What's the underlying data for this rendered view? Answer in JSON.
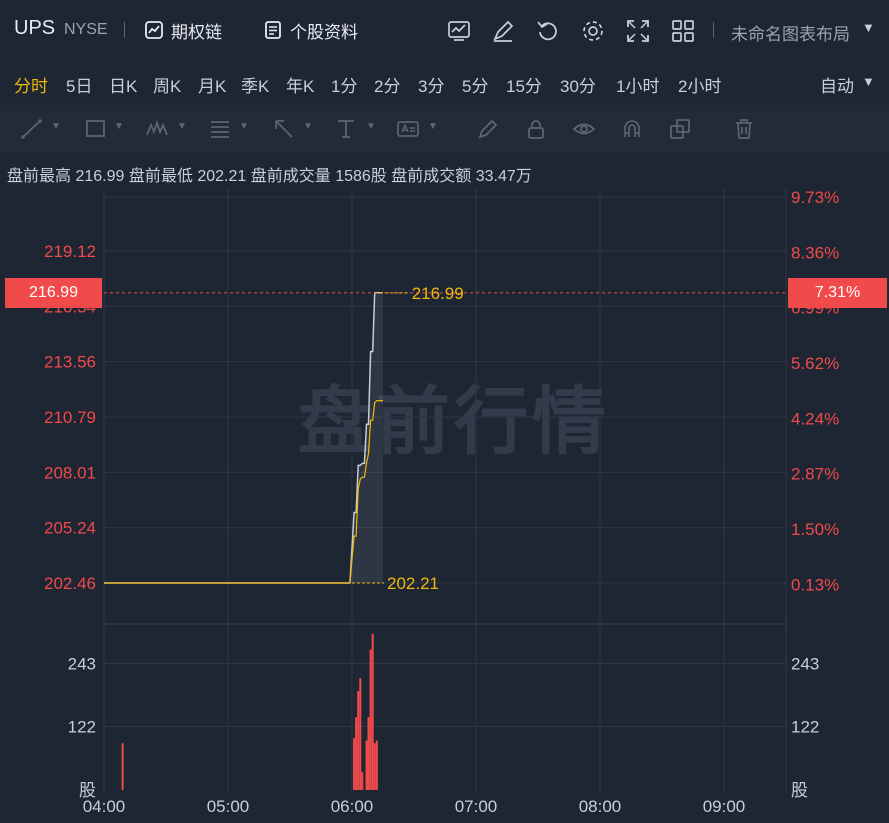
{
  "header": {
    "ticker": "UPS",
    "exchange": "NYSE",
    "options_chain_label": "期权链",
    "profile_label": "个股资料",
    "layout_name": "未命名图表布局"
  },
  "periods": [
    {
      "label": "分时",
      "active": true
    },
    {
      "label": "5日",
      "active": false
    },
    {
      "label": "日K",
      "active": false
    },
    {
      "label": "周K",
      "active": false
    },
    {
      "label": "月K",
      "active": false
    },
    {
      "label": "季K",
      "active": false
    },
    {
      "label": "年K",
      "active": false
    },
    {
      "label": "1分",
      "active": false
    },
    {
      "label": "2分",
      "active": false
    },
    {
      "label": "3分",
      "active": false
    },
    {
      "label": "5分",
      "active": false
    },
    {
      "label": "15分",
      "active": false
    },
    {
      "label": "30分",
      "active": false
    },
    {
      "label": "1小时",
      "active": false
    },
    {
      "label": "2小时",
      "active": false
    }
  ],
  "auto_label": "自动",
  "info": {
    "high_label": "盘前最高",
    "high_value": "216.99",
    "low_label": "盘前最低",
    "low_value": "202.21",
    "volume_label": "盘前成交量",
    "volume_value": "1586股",
    "amount_label": "盘前成交额",
    "amount_value": "33.47万"
  },
  "watermark": "盘前行情",
  "colors": {
    "up": "#f04a4a",
    "avg": "#f0b90b",
    "price": "#c8ccd4",
    "bg": "#1e2533",
    "grid": "#2f3746"
  },
  "chart_data": [
    {
      "type": "line",
      "title": "",
      "x_ticks": [
        "04:00",
        "05:00",
        "06:00",
        "07:00",
        "08:00",
        "09:00"
      ],
      "y_ticks_left": [
        "219.12",
        "216.34",
        "213.56",
        "210.79",
        "208.01",
        "205.24",
        "202.46"
      ],
      "y_ticks_right": [
        "9.73%",
        "8.36%",
        "6.99%",
        "5.62%",
        "4.24%",
        "2.87%",
        "1.50%",
        "0.13%"
      ],
      "ylim": [
        202.21,
        219.12
      ],
      "current_price_label": "216.99",
      "current_pct_label": "7.31%",
      "high_marker": "216.99",
      "low_marker": "202.21",
      "series": [
        {
          "x": [
            "04:00",
            "05:59",
            "06:01",
            "06:02",
            "06:03",
            "06:04",
            "06:05",
            "06:06",
            "06:07",
            "06:08",
            "06:09",
            "06:10",
            "06:11",
            "06:12",
            "06:13",
            "06:14",
            "06:15"
          ],
          "values": [
            202.21,
            202.21,
            205.8,
            205.8,
            208.2,
            208.2,
            208.3,
            208.3,
            210.3,
            210.3,
            214.0,
            214.0,
            216.99,
            216.99,
            216.99,
            216.99,
            216.99
          ]
        },
        {
          "x": [
            "04:00",
            "05:59",
            "06:01",
            "06:02",
            "06:03",
            "06:04",
            "06:05",
            "06:06",
            "06:07",
            "06:08",
            "06:09",
            "06:10",
            "06:11",
            "06:12",
            "06:13",
            "06:14",
            "06:15"
          ],
          "values": [
            202.21,
            202.21,
            204.6,
            204.6,
            207.0,
            207.5,
            207.6,
            207.6,
            208.3,
            208.8,
            210.5,
            210.5,
            211.4,
            211.5,
            211.5,
            211.5,
            211.5
          ]
        }
      ]
    },
    {
      "type": "bar",
      "title": "",
      "y_ticks": [
        "243",
        "122"
      ],
      "y_unit": "股",
      "ylim": [
        0,
        365
      ],
      "x": [
        "04:09",
        "06:01",
        "06:02",
        "06:03",
        "06:04",
        "06:05",
        "06:07",
        "06:08",
        "06:09",
        "06:10",
        "06:11",
        "06:12"
      ],
      "values": [
        90,
        100,
        140,
        190,
        215,
        35,
        95,
        140,
        270,
        300,
        90,
        95
      ]
    }
  ]
}
